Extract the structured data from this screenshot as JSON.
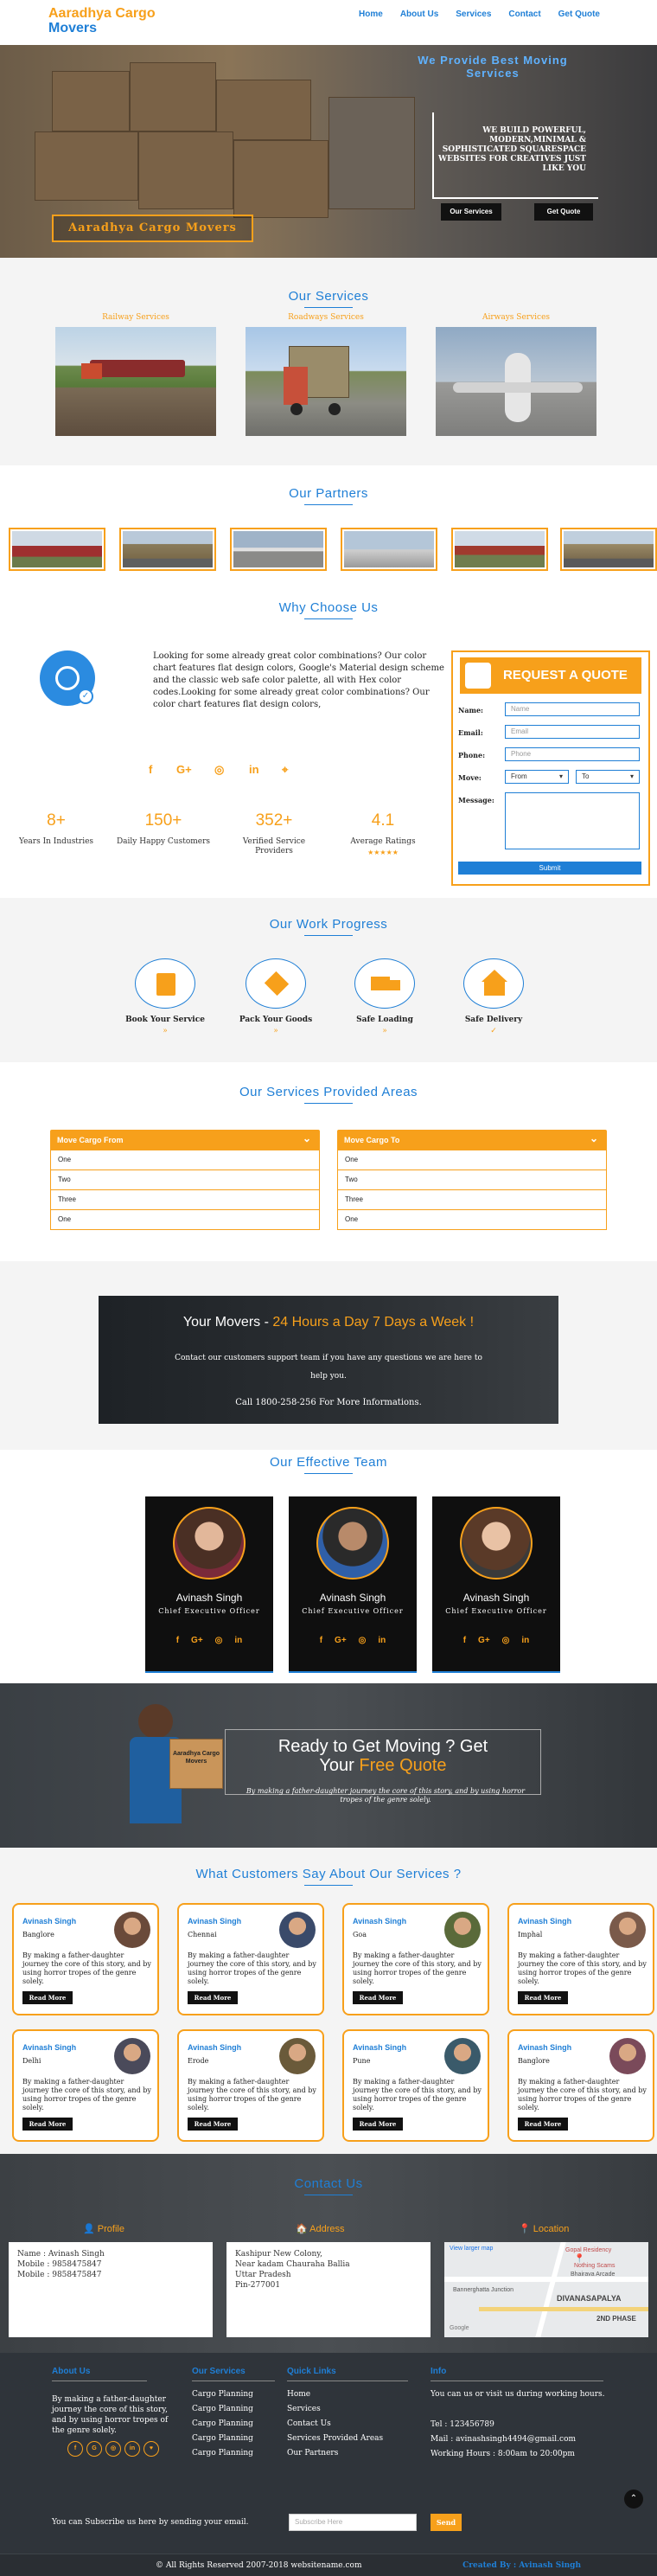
{
  "header": {
    "logo_line1": "Aaradhya Cargo",
    "logo_line2": "Movers",
    "nav": [
      "Home",
      "About Us",
      "Services",
      "Contact",
      "Get Quote"
    ]
  },
  "hero": {
    "title": "We Provide Best Moving Services",
    "subtitle": "WE BUILD POWERFUL, MODERN,MINIMAL & SOPHISTICATED SQUARESPACE WEBSITES FOR CREATIVES JUST LIKE YOU",
    "btn_services": "Our Services",
    "btn_quote": "Get Quote",
    "brand": "Aaradhya Cargo Movers"
  },
  "services": {
    "title": "Our Services",
    "items": [
      "Railway Services",
      "Roadways Services",
      "Airways Services"
    ]
  },
  "partners": {
    "title": "Our Partners"
  },
  "why": {
    "title": "Why Choose Us",
    "text": "Looking for some already great color combinations? Our color chart features flat design colors, Google's Material design scheme and the classic web safe color palette, all with Hex color codes.Looking for some already great color combinations? Our color chart features flat design colors,",
    "social": [
      "f",
      "G+",
      "◎",
      "in",
      "⌖"
    ],
    "stats": [
      {
        "num": "8+",
        "label": "Years In Industries"
      },
      {
        "num": "150+",
        "label": "Daily Happy Customers"
      },
      {
        "num": "352+",
        "label": "Verified Service Providers"
      },
      {
        "num": "4.1",
        "label": "Average Ratings"
      }
    ],
    "stars": "★★★★★"
  },
  "quote": {
    "header": "REQUEST A QUOTE",
    "name_label": "Name:",
    "name_ph": "Name",
    "email_label": "Email:",
    "email_ph": "Email",
    "phone_label": "Phone:",
    "phone_ph": "Phone",
    "move_label": "Move:",
    "from": "From",
    "to": "To",
    "message_label": "Message:",
    "submit": "Submit"
  },
  "work": {
    "title": "Our Work Progress",
    "steps": [
      {
        "label": "Book Your Service",
        "mark": "»"
      },
      {
        "label": "Pack Your Goods",
        "mark": "»"
      },
      {
        "label": "Safe Loading",
        "mark": "»"
      },
      {
        "label": "Safe Delivery",
        "mark": "✓"
      }
    ]
  },
  "areas": {
    "title": "Our Services Provided Areas",
    "from_label": "Move Cargo From",
    "to_label": "Move Cargo To",
    "options": [
      "One",
      "Two",
      "Three",
      "One"
    ]
  },
  "movers": {
    "title_a": "Your Movers - ",
    "title_b": "24 Hours a Day 7 Days a Week !",
    "sub": "Contact our customers support team if you have any questions we are here to help you.",
    "call": "Call 1800-258-256 For More Informations."
  },
  "team": {
    "title": "Our Effective Team",
    "members": [
      {
        "name": "Avinash Singh",
        "role": "Chief Executive Officer"
      },
      {
        "name": "Avinash Singh",
        "role": "Chief Executive Officer"
      },
      {
        "name": "Avinash Singh",
        "role": "Chief Executive Officer"
      }
    ],
    "social": [
      "f",
      "G+",
      "◎",
      "in"
    ]
  },
  "ready": {
    "title_a": "Ready to Get Moving ? Get",
    "title_b": "Your ",
    "title_c": "Free Quote",
    "sub": "By making a father-daughter journey the core of this story, and by using horror tropes of the genre solely.",
    "box_label": "Aaradhya Cargo Movers"
  },
  "testimonials": {
    "title": "What Customers Say About Our Services ?",
    "text": "By making a father-daughter journey the core of this story, and by using horror tropes of the genre solely.",
    "button": "Read More",
    "items": [
      {
        "name": "Avinash Singh",
        "city": "Banglore"
      },
      {
        "name": "Avinash Singh",
        "city": "Chennai"
      },
      {
        "name": "Avinash Singh",
        "city": "Goa"
      },
      {
        "name": "Avinash Singh",
        "city": "Imphal"
      },
      {
        "name": "Avinash Singh",
        "city": "Delhi"
      },
      {
        "name": "Avinash Singh",
        "city": "Erode"
      },
      {
        "name": "Avinash Singh",
        "city": "Pune"
      },
      {
        "name": "Avinash Singh",
        "city": "Banglore"
      }
    ]
  },
  "contact": {
    "title": "Contact Us",
    "profile_label": "Profile",
    "address_label": "Address",
    "location_label": "Location",
    "profile": [
      "Name : Avinash Singh",
      "Mobile : 9858475847",
      "Mobile : 9858475847"
    ],
    "address": [
      "Kashipur New Colony,",
      "Near kadam Chauraha Ballia",
      "Uttar Pradesh",
      "Pin-277001"
    ],
    "map_labels": [
      "View larger map",
      "Gopal Residency",
      "Nothing Scams",
      "Bhairava Arcade",
      "Bannerghatta Junction",
      "DIVANASAPALYA",
      "2ND PHASE",
      "Google"
    ]
  },
  "footer": {
    "about_h": "About Us",
    "about_text": "By making a father-daughter journey the core of this story, and by using horror tropes of the genre solely.",
    "about_social": [
      "f",
      "G",
      "◎",
      "in",
      "♥"
    ],
    "services_h": "Our Services",
    "services": [
      "Cargo Planning",
      "Cargo Planning",
      "Cargo Planning",
      "Cargo Planning",
      "Cargo Planning"
    ],
    "links_h": "Quick Links",
    "links": [
      "Home",
      "Services",
      "Contact Us",
      "Services Provided Areas",
      "Our Partners"
    ],
    "info_h": "Info",
    "info_intro": "You can us or visit us during working hours.",
    "tel": "Tel : 123456789",
    "mail": "Mail : avinashsingh4494@gmail.com",
    "hours": "Working Hours : 8:00am to 20:00pm",
    "subscribe_text": "You can Subscribe us here by sending your email.",
    "subscribe_ph": "Subscribe Here",
    "send": "Send",
    "copyright": "© All Rights Reserved 2007-2018 websitename.com",
    "credit": "Created By : Avinash Singh"
  },
  "colors": {
    "accent": "#1f7fd6",
    "brand": "#f7a01b",
    "dark": "#2f343a"
  }
}
